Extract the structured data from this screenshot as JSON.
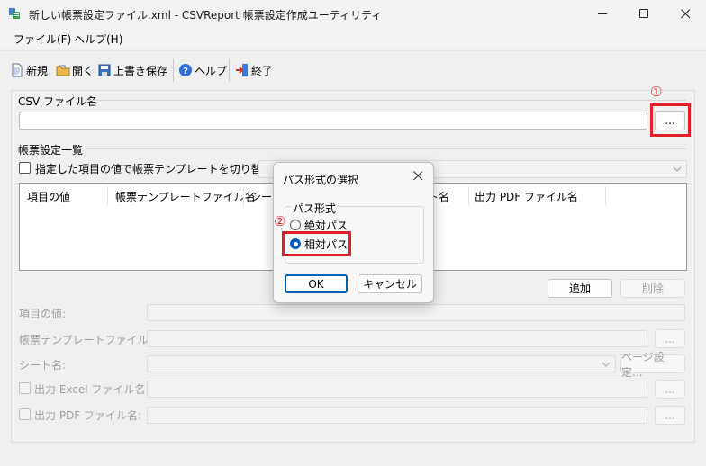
{
  "window": {
    "title": "新しい帳票設定ファイル.xml - CSVReport 帳票設定作成ユーティリティ"
  },
  "menu": [
    {
      "label": "ファイル(F)"
    },
    {
      "label": "ヘルプ(H)"
    }
  ],
  "toolbar": {
    "new_label": "新規",
    "open_label": "開く",
    "save_label": "上書き保存",
    "help_label": "ヘルプ",
    "exit_label": "終了"
  },
  "csv": {
    "group_label": "CSV ファイル名",
    "value": "",
    "browse_label": "..."
  },
  "report": {
    "group_label": "帳票設定一覧",
    "switch_checkbox_label": "指定した項目の値で帳票テンプレートを切り替える:",
    "columns": [
      "項目の値",
      "帳票テンプレートファイル名",
      "シー",
      "ト名",
      "出力 PDF ファイル名"
    ],
    "add_label": "追加",
    "delete_label": "削除"
  },
  "fields": {
    "item_value_label": "項目の値:",
    "template_label": "帳票テンプレートファイル名:",
    "sheet_label": "シート名:",
    "page_setup_label": "ページ設定...",
    "excel_label": "出力 Excel ファイル名:",
    "pdf_label": "出力 PDF ファイル名:",
    "browse_label": "..."
  },
  "dialog": {
    "title": "パス形式の選択",
    "group_label": "パス形式",
    "options": [
      {
        "label": "絶対パス",
        "checked": false
      },
      {
        "label": "相対パス",
        "checked": true
      }
    ],
    "ok_label": "OK",
    "cancel_label": "キャンセル"
  },
  "annotations": {
    "step1": "①",
    "step2": "②",
    "color": "#e0202a"
  }
}
